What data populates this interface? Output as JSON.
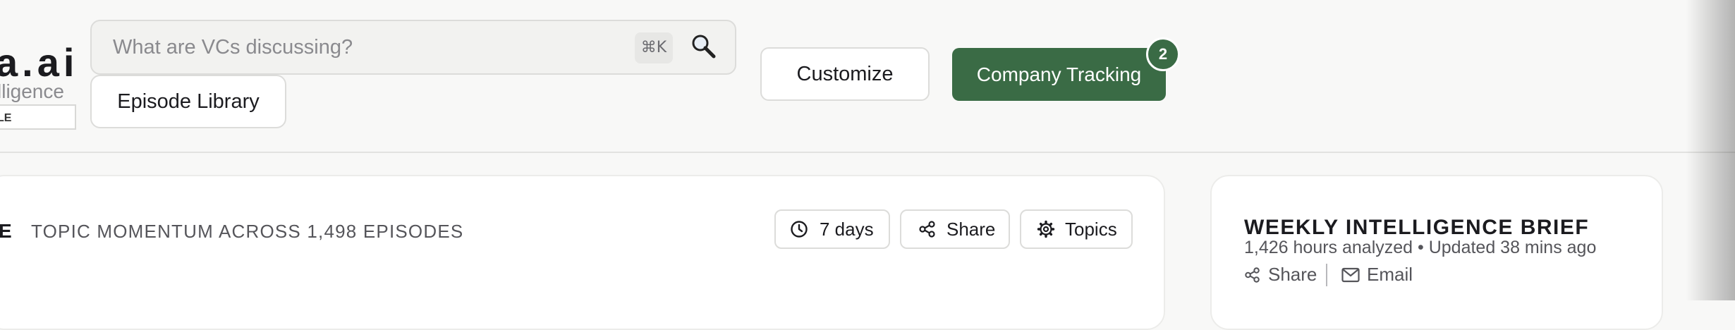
{
  "logo": {
    "text": "a.ai",
    "subtitle": "lligence",
    "badge": "LE"
  },
  "search": {
    "placeholder": "What are VCs discussing?",
    "shortcut": "⌘K",
    "icon": "search-icon"
  },
  "header": {
    "episode_library": "Episode Library",
    "customize": "Customize",
    "company_tracking": "Company Tracking",
    "company_tracking_count": "2",
    "accent_color": "#3a6b45"
  },
  "main": {
    "section_letter": "E",
    "subtitle": "TOPIC MOMENTUM ACROSS 1,498 EPISODES",
    "controls": [
      {
        "label": "7 days",
        "icon": "clock-icon"
      },
      {
        "label": "Share",
        "icon": "share-icon"
      },
      {
        "label": "Topics",
        "icon": "gear-icon"
      }
    ]
  },
  "brief": {
    "title": "WEEKLY INTELLIGENCE BRIEF",
    "meta": "1,426 hours analyzed • Updated 38 mins ago",
    "share": "Share",
    "email": "Email"
  }
}
